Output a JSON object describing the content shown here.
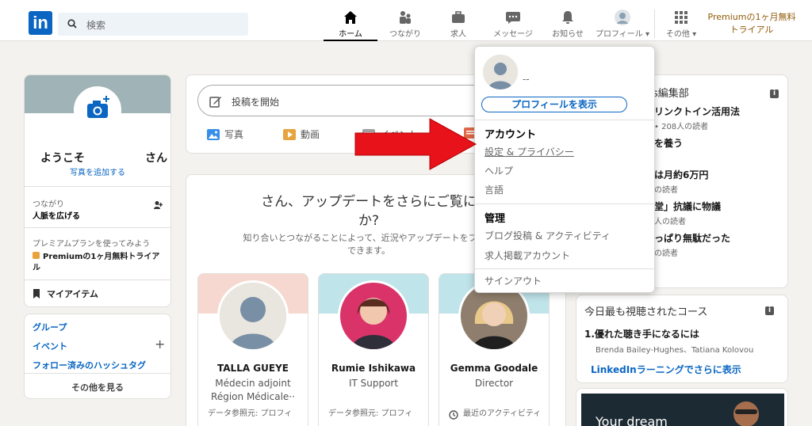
{
  "nav": {
    "logo": "in",
    "search_placeholder": "検索",
    "items": [
      {
        "label": "ホーム",
        "icon": "home-icon"
      },
      {
        "label": "つながり",
        "icon": "network-icon"
      },
      {
        "label": "求人",
        "icon": "jobs-icon"
      },
      {
        "label": "メッセージ",
        "icon": "messaging-icon"
      },
      {
        "label": "お知らせ",
        "icon": "bell-icon"
      },
      {
        "label": "プロフィール",
        "icon": "avatar"
      },
      {
        "label": "その他",
        "icon": "grid-icon"
      }
    ],
    "premium_line1": "Premiumの1ヶ月無料",
    "premium_line2": "トライアル"
  },
  "left": {
    "welcome": "ようこそ",
    "san": "さん",
    "add_photo": "写真を追加する",
    "connections_label": "つながり",
    "connections_sub": "人脈を広げる",
    "premium_prompt": "プレミアムプランを使ってみよう",
    "premium_trial": "Premiumの1ヶ月無料トライアル",
    "my_items": "マイアイテム",
    "groups": "グループ",
    "events": "イベント",
    "hashtags": "フォロー済みのハッシュタグ",
    "see_more": "その他を見る"
  },
  "feed": {
    "start_post": "投稿を開始",
    "actions": [
      {
        "label": "写真",
        "icon": "photo-icon",
        "color": "#378fe9"
      },
      {
        "label": "動画",
        "icon": "video-icon",
        "color": "#e7a33e"
      },
      {
        "label": "イベント",
        "icon": "event-icon",
        "color": "#8f7ab5"
      }
    ],
    "pymk_title_line1": "さん、アップデートをさらにご覧に",
    "pymk_title_line2": "か?",
    "pymk_sub_line1": "知り合いとつながることによって、近況やアップデートをフィー",
    "pymk_sub_line2": "できます。",
    "people": [
      {
        "name": "TALLA GUEYE",
        "line1": "Médecin adjoint",
        "line2": "Région Médicale··",
        "footer": "データ参照元: プロフィ",
        "banner": "#f7d8d0"
      },
      {
        "name": "Rumie Ishikawa",
        "line1": "IT Support",
        "line2": "",
        "footer": "データ参照元: プロフィ",
        "banner": "#bfe4ea"
      },
      {
        "name": "Gemma Goodale",
        "line1": "Director",
        "line2": "",
        "footer": "最近のアクティビティ",
        "banner": "#bfe4ea"
      }
    ]
  },
  "right": {
    "news_title": "s編集部",
    "news": [
      {
        "title": "リンクトイン活用法",
        "sub": "• 208人の読者"
      },
      {
        "title": "を養う",
        "sub": ""
      },
      {
        "title": "は月約6万円",
        "sub": "の読者"
      },
      {
        "title": "堂」抗議に物議",
        "sub": "人の読者"
      },
      {
        "title": "っぱり無駄だった",
        "sub": "の読者"
      }
    ],
    "courses_title": "今日最も視聴されたコース",
    "course_item": "1.優れた聴き手になるには",
    "course_authors": "Brenda Bailey-Hughes、Tatiana Kolovou",
    "learning_link": "LinkedInラーニングでさらに表示",
    "ad_text": "Your dream"
  },
  "dropdown": {
    "name": "--",
    "view_profile": "プロフィールを表示",
    "account_head": "アカウント",
    "settings": "設定 & プライバシー",
    "help": "ヘルプ",
    "language": "言語",
    "manage_head": "管理",
    "posts": "ブログ投稿 & アクティビティ",
    "job_account": "求人掲載アカウント",
    "signout": "サインアウト"
  },
  "colors": {
    "brand": "#0a66c2",
    "arrow": "#e8121b",
    "premium": "#915907"
  }
}
